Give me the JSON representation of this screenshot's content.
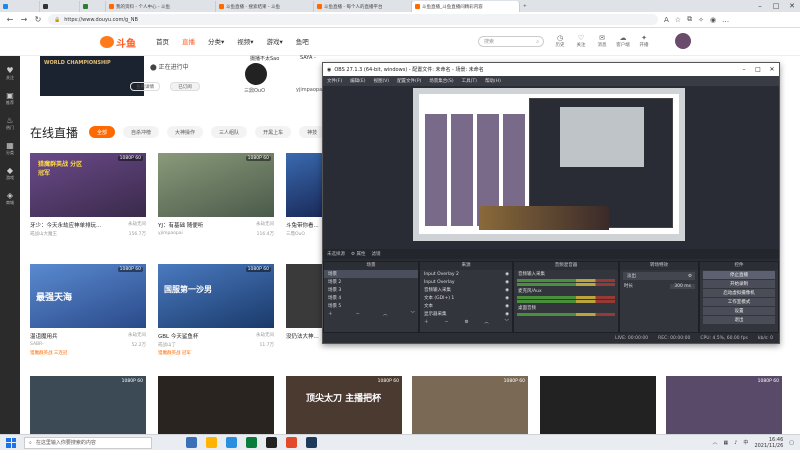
{
  "browser": {
    "tabs": [
      {
        "label": "我的资料 - 个人中心 - 斗鱼",
        "color": "#ff6a00"
      },
      {
        "label": "斗鱼直播 - 搜索结果 - 斗鱼",
        "color": "#ff6a00"
      },
      {
        "label": "斗鱼直播 - 每个人的直播平台",
        "color": "#ff6a00"
      },
      {
        "label": "斗鱼直播_斗鱼直播间精彩内容",
        "color": "#ff6a00"
      }
    ],
    "url": "https://www.douyu.com/g_NB",
    "window_controls": [
      "–",
      "□",
      "✕"
    ]
  },
  "header": {
    "logo_text": "斗鱼",
    "nav": [
      "首页",
      "直播",
      "分类▾",
      "视频▾",
      "游戏▾",
      "鱼吧"
    ],
    "nav_active_index": 1,
    "search_placeholder": "搜索",
    "icons": [
      {
        "icon": "history-icon",
        "label": "历史"
      },
      {
        "icon": "follow-icon",
        "label": "关注"
      },
      {
        "icon": "message-icon",
        "label": "消息"
      },
      {
        "icon": "cloud-download-icon",
        "label": "客户端"
      },
      {
        "icon": "star-icon",
        "label": "开播"
      }
    ]
  },
  "sidebar": [
    {
      "icon": "heart-icon",
      "label": "关注"
    },
    {
      "icon": "recommend-icon",
      "label": "推荐"
    },
    {
      "icon": "fire-icon",
      "label": "热门"
    },
    {
      "icon": "grid-icon",
      "label": "分类"
    },
    {
      "icon": "controller-icon",
      "label": "游戏"
    },
    {
      "icon": "bag-icon",
      "label": "商城"
    }
  ],
  "top": {
    "banner_text": "WORLD CHAMPIONSHIP",
    "live_status": "正在进行中",
    "btn_view": "查看详情",
    "btn_sub": "已订阅",
    "rec1_title": "摄播不太Sao",
    "rec1_name": "三鼎OuO",
    "rec2_title": "SAYA -",
    "rec2_name": "yjimpaopai"
  },
  "section": {
    "title": "在线直播",
    "filters": [
      "全部",
      "自杀冲榜",
      "大神操作",
      "三人组队",
      "开黑上车",
      "神技"
    ]
  },
  "cards": [
    {
      "title": "牙少：今天永劫应神单排玩...",
      "cat": "永劫无间",
      "user": "戒战山大魔王",
      "viewers": "156.7万",
      "tag": "猎魔群英战 分区冠军",
      "color": "#5a4a7a"
    },
    {
      "title": "YJ：有基础 随便听",
      "cat": "永劫无间",
      "user": "yjimpaopai",
      "viewers": "116.4万",
      "tag": "猎魔群英战 技术流",
      "color": "#6b7a6a"
    },
    {
      "title": "斗兔带你看...",
      "cat": "永劫无间",
      "user": "三鼎OuO",
      "viewers": "",
      "tag": "猎魔群英战",
      "color": "#2f4a7a"
    },
    {
      "title": "温诅魔用兵",
      "cat": "永劫无间",
      "user": "SABR-",
      "viewers": "52.2万",
      "tag": "猎魔群英战 三连冠",
      "color": "#5080c0"
    },
    {
      "title": "GBL 今天鲨鱼杯",
      "cat": "永劫无间",
      "user": "戒战山丁",
      "viewers": "11.7万",
      "tag": "猎魔群英战 冠军",
      "color": "#3a6aa0"
    },
    {
      "title": "没仍法大神...",
      "cat": "永劫无间",
      "user": "",
      "viewers": "",
      "tag": "",
      "color": "#3a3a3a"
    }
  ],
  "row3": [
    {
      "color": "#3b4a55"
    },
    {
      "color": "#2a2420"
    },
    {
      "color": "#4a3a30"
    },
    {
      "color": "#7a6a55"
    },
    {
      "color": "#222"
    },
    {
      "color": "#5a4a6a"
    }
  ],
  "row3_labels": [
    "顶尖太刀 主播把杯"
  ],
  "obs": {
    "title": "OBS 27.1.3 (64-bit, windows) - 配置文件: 未命名 - 场景: 未命名",
    "menu": [
      "文件(F)",
      "编辑(E)",
      "视图(V)",
      "配置文件(P)",
      "场景集合(S)",
      "工具(T)",
      "帮助(H)"
    ],
    "source_bar": [
      "未选择源",
      "⚙ 属性",
      "滤镜"
    ],
    "panels": {
      "scenes_title": "场景",
      "scenes": [
        "场景",
        "场景 2",
        "场景 3",
        "场景 4",
        "场景 5"
      ],
      "sources_title": "来源",
      "sources": [
        "Input Overlay 2",
        "Input Overlay",
        "音频输入采集",
        "文本 (GDI+) 1",
        "文本",
        "显示器采集"
      ],
      "mixer_title": "音频混音器",
      "mixer": [
        "音频输入采集",
        "麦克风/Aux",
        "桌面音频"
      ],
      "trans_title": "转场特效",
      "trans_value": "淡出",
      "trans_duration_label": "时长",
      "trans_duration": "300 ms",
      "ctrl_title": "控件",
      "controls": [
        "停止直播",
        "开始录制",
        "启动虚拟摄像机",
        "工作室模式",
        "设置",
        "退出"
      ]
    },
    "status": [
      "LIVE: 00:00:00",
      "REC: 00:00:00",
      "CPU: 4.5%, 60.00 fps",
      "kb/s: 0"
    ]
  },
  "taskbar": {
    "search_placeholder": "在这里输入你要搜索的内容",
    "time": "16:46",
    "date": "2021/11/26",
    "apps": [
      "#3b6fb6",
      "#2b8fe0",
      "#0a7d3a",
      "#ffb400",
      "#1e88e5",
      "#e34a2a",
      "#5c6bc0"
    ]
  }
}
